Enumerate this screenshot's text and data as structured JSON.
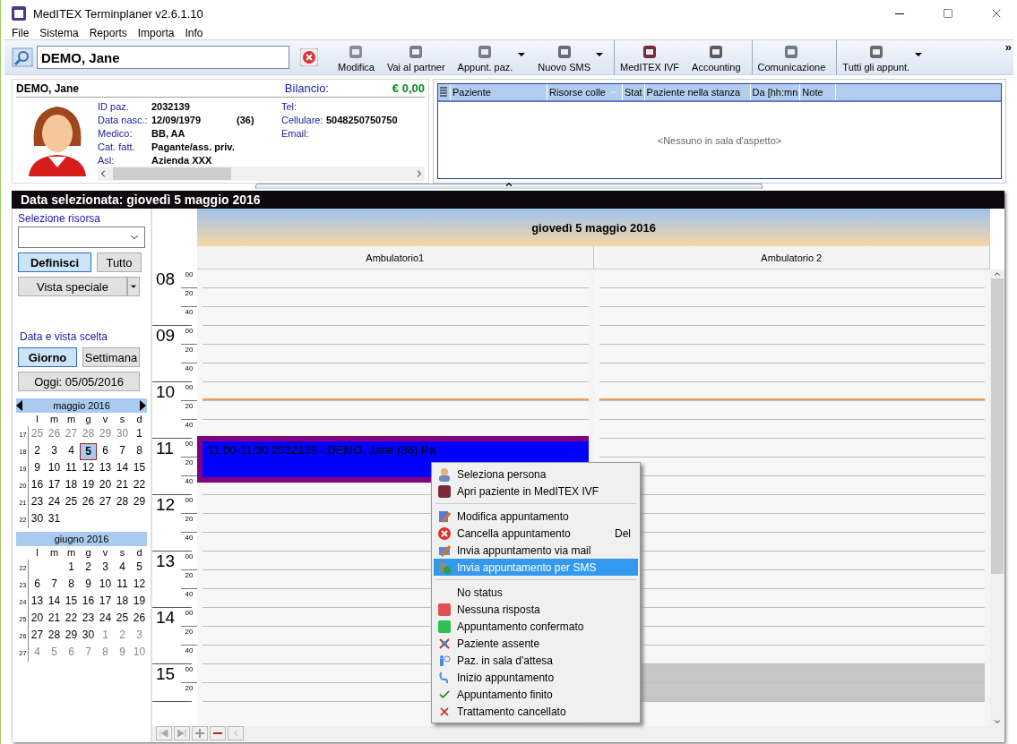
{
  "window": {
    "title": "MedITEX Terminplaner  v2.6.1.10"
  },
  "menu": [
    "File",
    "Sistema",
    "Reports",
    "Importa",
    "Info"
  ],
  "toolbar": {
    "search_value": "DEMO, Jane",
    "buttons": [
      {
        "label": "Modifica",
        "dropdown": false,
        "group_start": false
      },
      {
        "label": "Vai al partner",
        "dropdown": false,
        "group_start": false
      },
      {
        "label": "Appunt. paz.",
        "dropdown": true,
        "group_start": false
      },
      {
        "label": "Nuovo SMS",
        "dropdown": true,
        "group_start": false
      },
      {
        "label": "MedITEX IVF",
        "dropdown": false,
        "group_start": true
      },
      {
        "label": "Accounting",
        "dropdown": false,
        "group_start": false
      },
      {
        "label": "Comunicazione",
        "dropdown": false,
        "group_start": true
      },
      {
        "label": "Tutti gli appunt.",
        "dropdown": true,
        "group_start": true
      }
    ],
    "overflow": "»"
  },
  "patient": {
    "name": "DEMO, Jane",
    "balance_label": "Bilancio:",
    "balance": "€ 0,00",
    "fields_left": [
      {
        "label": "ID paz.",
        "value": "2032139"
      },
      {
        "label": "Data nasc.:",
        "value": "12/09/1979",
        "extra": "(36)"
      },
      {
        "label": "Medico:",
        "value": "BB, AA"
      },
      {
        "label": "Cat. fatt.",
        "value": "Pagante/ass. priv."
      },
      {
        "label": "Asl:",
        "value": "Azienda XXX"
      }
    ],
    "fields_right": [
      {
        "label": "Tel:"
      },
      {
        "label": "Cellulare:",
        "value": "5048250750750"
      },
      {
        "label": "Email:"
      }
    ]
  },
  "waiting_room": {
    "columns": [
      {
        "label": "Paziente",
        "sorted": false
      },
      {
        "label": "Risorse colle",
        "sorted": true
      },
      {
        "label": "Stat",
        "sorted": false
      },
      {
        "label": "Paziente nella stanza",
        "sorted": false
      },
      {
        "label": "Da [hh:mn",
        "sorted": false
      },
      {
        "label": "Note",
        "sorted": false
      }
    ],
    "empty_text": "<Nessuno in sala d'aspetto>"
  },
  "calendar": {
    "selected_date": "Data selezionata:  giovedì 5 maggio 2016",
    "resource_label": "Selezione risorsa",
    "define_button": {
      "label": "Definisci",
      "selected": true
    },
    "all_button": {
      "label": "Tutto",
      "selected": false
    },
    "special_view": "Vista speciale",
    "view_label": "Data e vista scelta",
    "view_buttons": [
      {
        "label": "Giorno",
        "selected": true
      },
      {
        "label": "Settimana",
        "selected": false
      }
    ],
    "today_button": "Oggi: 05/05/2016",
    "months": [
      {
        "title": "maggio 2016",
        "nav": true,
        "weekdays": [
          "l",
          "m",
          "m",
          "g",
          "v",
          "s",
          "d"
        ],
        "weeks": [
          {
            "week": "17",
            "days": [
              {
                "d": "25",
                "other": true,
                "selected": false
              },
              {
                "d": "26",
                "other": true,
                "selected": false
              },
              {
                "d": "27",
                "other": true,
                "selected": false
              },
              {
                "d": "28",
                "other": true,
                "selected": false
              },
              {
                "d": "29",
                "other": true,
                "selected": false
              },
              {
                "d": "30",
                "other": true,
                "selected": false
              },
              {
                "d": "1",
                "other": false,
                "selected": false
              }
            ]
          },
          {
            "week": "18",
            "days": [
              {
                "d": "2",
                "other": false,
                "selected": false
              },
              {
                "d": "3",
                "other": false,
                "selected": false
              },
              {
                "d": "4",
                "other": false,
                "selected": false
              },
              {
                "d": "5",
                "other": false,
                "selected": true
              },
              {
                "d": "6",
                "other": false,
                "selected": false
              },
              {
                "d": "7",
                "other": false,
                "selected": false
              },
              {
                "d": "8",
                "other": false,
                "selected": false
              }
            ]
          },
          {
            "week": "19",
            "days": [
              {
                "d": "9",
                "other": false,
                "selected": false
              },
              {
                "d": "10",
                "other": false,
                "selected": false
              },
              {
                "d": "11",
                "other": false,
                "selected": false
              },
              {
                "d": "12",
                "other": false,
                "selected": false
              },
              {
                "d": "13",
                "other": false,
                "selected": false
              },
              {
                "d": "14",
                "other": false,
                "selected": false
              },
              {
                "d": "15",
                "other": false,
                "selected": false
              }
            ]
          },
          {
            "week": "20",
            "days": [
              {
                "d": "16",
                "other": false,
                "selected": false
              },
              {
                "d": "17",
                "other": false,
                "selected": false
              },
              {
                "d": "18",
                "other": false,
                "selected": false
              },
              {
                "d": "19",
                "other": false,
                "selected": false
              },
              {
                "d": "20",
                "other": false,
                "selected": false
              },
              {
                "d": "21",
                "other": false,
                "selected": false
              },
              {
                "d": "22",
                "other": false,
                "selected": false
              }
            ]
          },
          {
            "week": "21",
            "days": [
              {
                "d": "23",
                "other": false,
                "selected": false
              },
              {
                "d": "24",
                "other": false,
                "selected": false
              },
              {
                "d": "25",
                "other": false,
                "selected": false
              },
              {
                "d": "26",
                "other": false,
                "selected": false
              },
              {
                "d": "27",
                "other": false,
                "selected": false
              },
              {
                "d": "28",
                "other": false,
                "selected": false
              },
              {
                "d": "29",
                "other": false,
                "selected": false
              }
            ]
          },
          {
            "week": "22",
            "kind": "partial_end",
            "days": [
              {
                "d": "30",
                "other": false,
                "selected": false
              },
              {
                "d": "31",
                "other": false,
                "selected": false
              }
            ]
          }
        ]
      },
      {
        "title": "giugno 2016",
        "nav": false,
        "weekdays": [
          "l",
          "m",
          "m",
          "g",
          "v",
          "s",
          "d"
        ],
        "weeks": [
          {
            "week": "22",
            "kind": "partial_start",
            "days": [
              {
                "d": "1",
                "other": false,
                "selected": false
              },
              {
                "d": "2",
                "other": false,
                "selected": false
              },
              {
                "d": "3",
                "other": false,
                "selected": false
              },
              {
                "d": "4",
                "other": false,
                "selected": false
              },
              {
                "d": "5",
                "other": false,
                "selected": false
              }
            ]
          },
          {
            "week": "23",
            "days": [
              {
                "d": "6",
                "other": false,
                "selected": false
              },
              {
                "d": "7",
                "other": false,
                "selected": false
              },
              {
                "d": "8",
                "other": false,
                "selected": false
              },
              {
                "d": "9",
                "other": false,
                "selected": false
              },
              {
                "d": "10",
                "other": false,
                "selected": false
              },
              {
                "d": "11",
                "other": false,
                "selected": false
              },
              {
                "d": "12",
                "other": false,
                "selected": false
              }
            ]
          },
          {
            "week": "24",
            "days": [
              {
                "d": "13",
                "other": false,
                "selected": false
              },
              {
                "d": "14",
                "other": false,
                "selected": false
              },
              {
                "d": "15",
                "other": false,
                "selected": false
              },
              {
                "d": "16",
                "other": false,
                "selected": false
              },
              {
                "d": "17",
                "other": false,
                "selected": false
              },
              {
                "d": "18",
                "other": false,
                "selected": false
              },
              {
                "d": "19",
                "other": false,
                "selected": false
              }
            ]
          },
          {
            "week": "25",
            "days": [
              {
                "d": "20",
                "other": false,
                "selected": false
              },
              {
                "d": "21",
                "other": false,
                "selected": false
              },
              {
                "d": "22",
                "other": false,
                "selected": false
              },
              {
                "d": "23",
                "other": false,
                "selected": false
              },
              {
                "d": "24",
                "other": false,
                "selected": false
              },
              {
                "d": "25",
                "other": false,
                "selected": false
              },
              {
                "d": "26",
                "other": false,
                "selected": false
              }
            ]
          },
          {
            "week": "26",
            "days": [
              {
                "d": "27",
                "other": false,
                "selected": false
              },
              {
                "d": "28",
                "other": false,
                "selected": false
              },
              {
                "d": "29",
                "other": false,
                "selected": false
              },
              {
                "d": "30",
                "other": false,
                "selected": false
              },
              {
                "d": "1",
                "other": true,
                "selected": false
              },
              {
                "d": "2",
                "other": true,
                "selected": false
              },
              {
                "d": "3",
                "other": true,
                "selected": false
              }
            ]
          },
          {
            "week": "27",
            "days": [
              {
                "d": "4",
                "other": true,
                "selected": false
              },
              {
                "d": "5",
                "other": true,
                "selected": false
              },
              {
                "d": "6",
                "other": true,
                "selected": false
              },
              {
                "d": "7",
                "other": true,
                "selected": false
              },
              {
                "d": "8",
                "other": true,
                "selected": false
              },
              {
                "d": "9",
                "other": true,
                "selected": false
              },
              {
                "d": "10",
                "other": true,
                "selected": false
              }
            ]
          }
        ]
      }
    ],
    "day_title": "giovedì 5 maggio 2016",
    "resources": [
      "Ambulatorio1",
      "Ambulatorio 2"
    ],
    "hours": [
      {
        "label": "08",
        "minutes": [
          "00",
          "20",
          "40"
        ],
        "now_line": false,
        "shaded": false
      },
      {
        "label": "09",
        "minutes": [
          "00",
          "20",
          "40"
        ],
        "now_line": false,
        "shaded": false
      },
      {
        "label": "10",
        "minutes": [
          "00",
          "20",
          "40"
        ],
        "now_line": true,
        "shaded": false
      },
      {
        "label": "11",
        "minutes": [
          "00",
          "20",
          "40"
        ],
        "now_line": false,
        "shaded": false,
        "appointment": {
          "text": "11:00-11:30 2032139 - DEMO, Jane (36) Pa"
        }
      },
      {
        "label": "12",
        "minutes": [
          "00",
          "20",
          "40"
        ],
        "now_line": false,
        "shaded": false
      },
      {
        "label": "13",
        "minutes": [
          "00",
          "20",
          "40"
        ],
        "now_line": false,
        "shaded": false
      },
      {
        "label": "14",
        "minutes": [
          "00",
          "20",
          "40"
        ],
        "now_line": false,
        "shaded": false
      },
      {
        "label": "15",
        "minutes": [
          "00",
          "20"
        ],
        "now_line": false,
        "shaded": true
      }
    ]
  },
  "context_menu": [
    {
      "kind": "item",
      "label": "Seleziona persona",
      "selected": false
    },
    {
      "kind": "item",
      "label": "Apri paziente in MedITEX IVF",
      "selected": false
    },
    {
      "kind": "separator"
    },
    {
      "kind": "item",
      "label": "Modifica appuntamento",
      "selected": false
    },
    {
      "kind": "item",
      "label": "Cancella appuntamento",
      "shortcut": "Del",
      "selected": false
    },
    {
      "kind": "item",
      "label": "Invia appuntamento via mail",
      "selected": false
    },
    {
      "kind": "item",
      "label": "Invia appuntamento per SMS",
      "selected": true
    },
    {
      "kind": "separator"
    },
    {
      "kind": "item",
      "label": "No status",
      "selected": false
    },
    {
      "kind": "item",
      "label": "Nessuna risposta",
      "selected": false
    },
    {
      "kind": "item",
      "label": "Appuntamento confermato",
      "selected": false
    },
    {
      "kind": "item",
      "label": "Paziente assente",
      "selected": false
    },
    {
      "kind": "item",
      "label": "Paz. in sala d'attesa",
      "selected": false
    },
    {
      "kind": "item",
      "label": "Inizio appuntamento",
      "selected": false
    },
    {
      "kind": "item",
      "label": "Appuntamento finito",
      "selected": false
    },
    {
      "kind": "item",
      "label": "Trattamento cancellato",
      "selected": false
    }
  ]
}
